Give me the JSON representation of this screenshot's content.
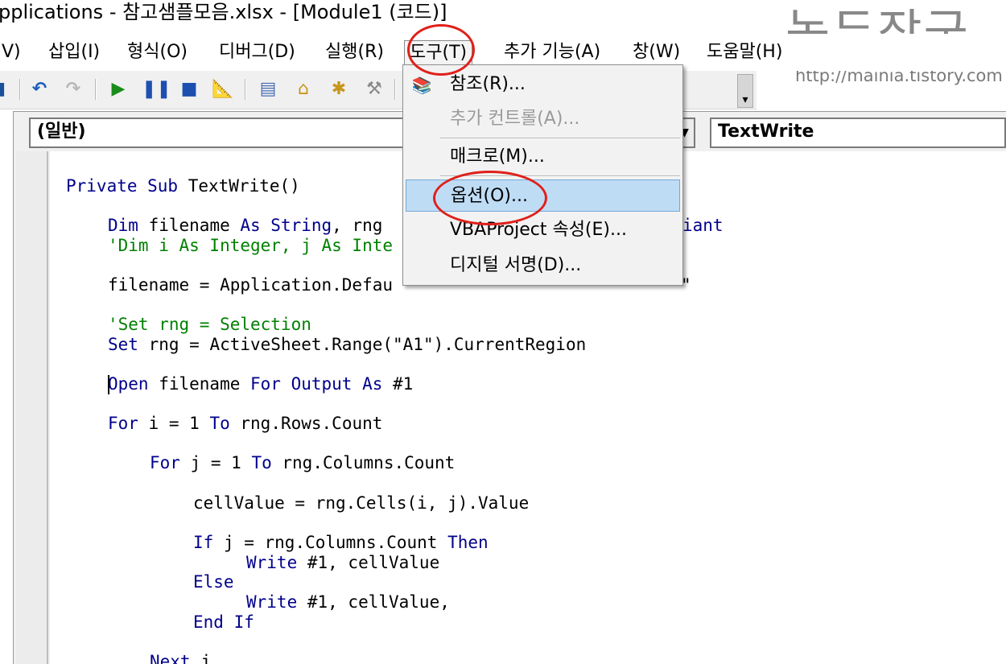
{
  "window": {
    "title": "pplications - 참고샘플모음.xlsx - [Module1 (코드)]"
  },
  "watermark": {
    "name": "녹두장군",
    "url": "http://mainia.tistory.com"
  },
  "menubar": {
    "items": [
      {
        "label": "V)"
      },
      {
        "label": "삽입(I)"
      },
      {
        "label": "형식(O)"
      },
      {
        "label": "디버그(D)"
      },
      {
        "label": "실행(R)"
      },
      {
        "label": "도구(T)"
      },
      {
        "label": "추가 기능(A)"
      },
      {
        "label": "창(W)"
      },
      {
        "label": "도움말(H)"
      }
    ],
    "active_index": 5
  },
  "toolbar": {
    "icons": [
      "insert-icon",
      "undo-icon",
      "redo-icon",
      "run-icon",
      "pause-icon",
      "stop-icon",
      "design-mode-icon",
      "project-explorer-icon",
      "properties-icon",
      "object-browser-icon",
      "toolbox-icon"
    ]
  },
  "code_window": {
    "object_combo": "(일반)",
    "procedure_combo": "TextWrite"
  },
  "tools_menu": {
    "items": [
      {
        "label": "참조(R)...",
        "enabled": true
      },
      {
        "label": "추가 컨트롤(A)...",
        "enabled": false
      },
      {
        "label": "매크로(M)...",
        "enabled": true
      },
      {
        "label": "옵션(O)...",
        "enabled": true,
        "highlighted": true
      },
      {
        "label": "VBAProject 속성(E)...",
        "enabled": true
      },
      {
        "label": "디지털 서명(D)...",
        "enabled": true
      }
    ]
  },
  "code": {
    "l1_kw": "Private Sub",
    "l1_tx": " TextWrite()",
    "l2_kw": "Dim",
    "l2_tx": " filename ",
    "l2_kw2": "As String",
    "l2_tx2": ", rng",
    "l2_tail": "iant",
    "l3_cm": "'Dim i As Integer, j As Inte",
    "l4_tx": "filename = Application.Defau",
    "l4_tail": "\"",
    "l5_cm": "'Set rng = Selection",
    "l6_kw": "Set",
    "l6_tx": " rng = ActiveSheet.Range(\"A1\").CurrentRegion",
    "l7_kw": "Open",
    "l7_tx": " filename ",
    "l7_kw2": "For Output As",
    "l7_tx2": " #1",
    "l8_kw": "For",
    "l8_tx": " i = 1 ",
    "l8_kw2": "To",
    "l8_tx2": " rng.Rows.Count",
    "l9_kw": "For",
    "l9_tx": " j = 1 ",
    "l9_kw2": "To",
    "l9_tx2": " rng.Columns.Count",
    "l10_tx": "cellValue = rng.Cells(i, j).Value",
    "l11_kw": "If",
    "l11_tx": " j = rng.Columns.Count ",
    "l11_kw2": "Then",
    "l12_kw": "Write",
    "l12_tx": " #1, cellValue",
    "l13_kw": "Else",
    "l14_kw": "Write",
    "l14_tx": " #1, cellValue,",
    "l15_kw": "End If",
    "l16_kw": "Next",
    "l16_tx": " j"
  }
}
